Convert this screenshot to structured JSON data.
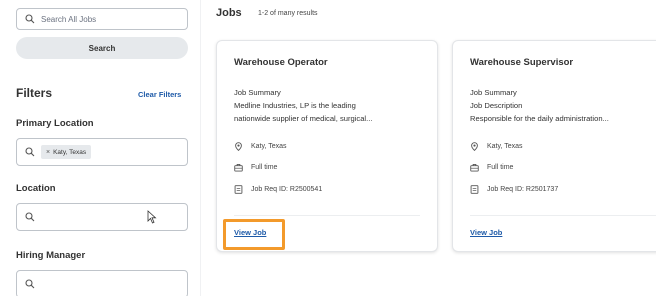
{
  "sidebar": {
    "search_placeholder": "Search All Jobs",
    "search_button": "Search",
    "filters_title": "Filters",
    "clear_filters": "Clear Filters",
    "primary_location_label": "Primary Location",
    "primary_location_chip": "Katy, Texas",
    "location_label": "Location",
    "hiring_manager_label": "Hiring Manager"
  },
  "main": {
    "title": "Jobs",
    "results": "1-2 of many results",
    "cards": [
      {
        "title": "Warehouse Operator",
        "line1": "Job Summary",
        "line2": "Medline Industries, LP is the leading",
        "line3": "nationwide supplier of medical, surgical...",
        "location": "Katy, Texas",
        "time_type": "Full time",
        "req_id": "Job Req ID: R2500541",
        "view_job": "View Job"
      },
      {
        "title": "Warehouse Supervisor",
        "line1": "Job Summary",
        "line2": "Job Description",
        "line3": "Responsible for the daily administration...",
        "location": "Katy, Texas",
        "time_type": "Full time",
        "req_id": "Job Req ID: R2501737",
        "view_job": "View Job"
      }
    ]
  },
  "colors": {
    "link": "#1e5aa8",
    "highlight": "#f39a2b",
    "button_bg": "#e6e9ec"
  },
  "icons": [
    "search-icon",
    "close-icon",
    "location-pin-icon",
    "briefcase-icon",
    "document-icon",
    "mouse-cursor-icon"
  ]
}
